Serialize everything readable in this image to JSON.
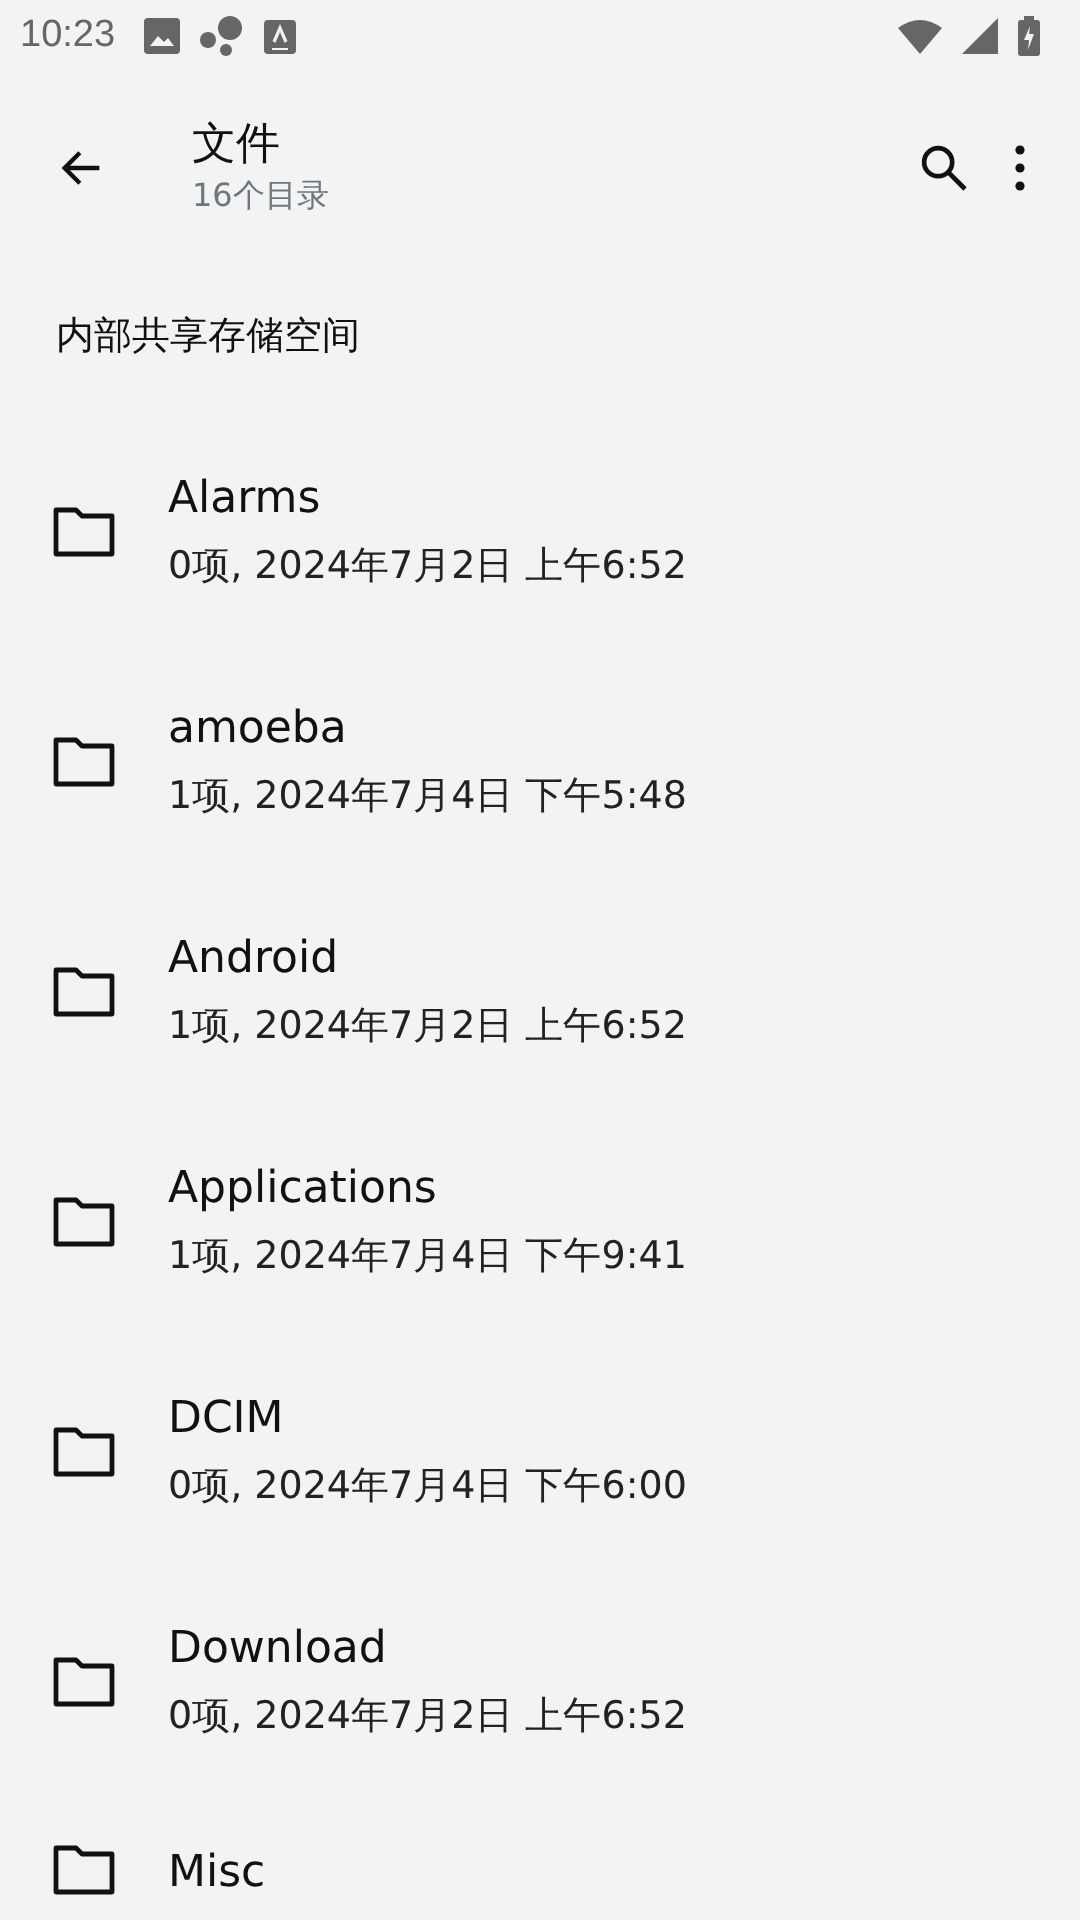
{
  "status_bar": {
    "time": "10:23"
  },
  "toolbar": {
    "title": "文件",
    "subtitle": "16个目录"
  },
  "section": {
    "title": "内部共享存储空间"
  },
  "folders": [
    {
      "name": "Alarms",
      "detail": "0项, 2024年7月2日 上午6:52"
    },
    {
      "name": "amoeba",
      "detail": "1项, 2024年7月4日 下午5:48"
    },
    {
      "name": "Android",
      "detail": "1项, 2024年7月2日 上午6:52"
    },
    {
      "name": "Applications",
      "detail": "1项, 2024年7月4日 下午9:41"
    },
    {
      "name": "DCIM",
      "detail": "0项, 2024年7月4日 下午6:00"
    },
    {
      "name": "Download",
      "detail": "0项, 2024年7月2日 上午6:52"
    },
    {
      "name": "Misc"
    }
  ]
}
